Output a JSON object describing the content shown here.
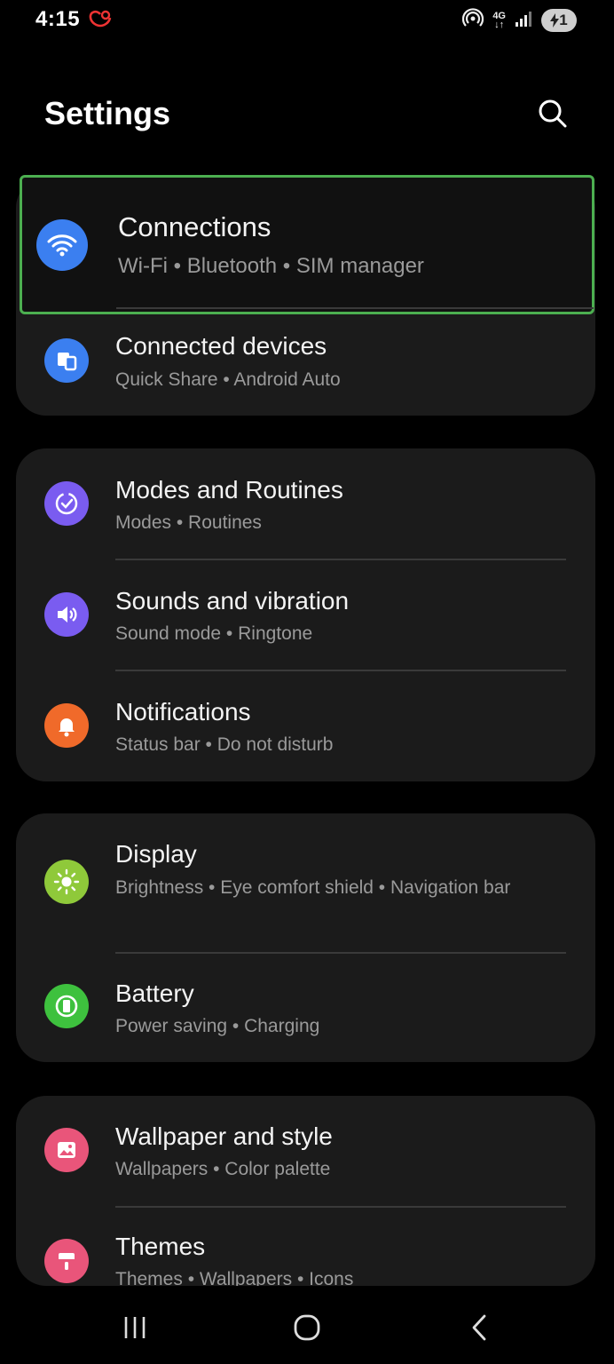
{
  "status_bar": {
    "time": "4:15",
    "network_label_top": "4G",
    "network_label_bottom": "↓↑",
    "battery_level": "1"
  },
  "header": {
    "title": "Settings"
  },
  "colors": {
    "highlight_border": "#4caf50",
    "card_background": "#1b1b1b",
    "connections_icon": "#3b7ff0",
    "connected_devices_icon": "#3b7ff0",
    "modes_icon": "#7a5cf0",
    "sounds_icon": "#7a5cf0",
    "notifications_icon": "#f06a2a",
    "display_icon": "#8fc93a",
    "battery_icon": "#3ec13e",
    "wallpaper_icon": "#e9557a",
    "themes_icon": "#e9557a"
  },
  "items": {
    "connections": {
      "title": "Connections",
      "subtitle": "Wi-Fi  •  Bluetooth  •  SIM manager",
      "icon": "wifi-icon"
    },
    "connected_devices": {
      "title": "Connected devices",
      "subtitle": "Quick Share  •  Android Auto",
      "icon": "devices-icon"
    },
    "modes_routines": {
      "title": "Modes and Routines",
      "subtitle": "Modes  •  Routines",
      "icon": "modes-icon"
    },
    "sounds": {
      "title": "Sounds and vibration",
      "subtitle": "Sound mode  •  Ringtone",
      "icon": "speaker-icon"
    },
    "notifications": {
      "title": "Notifications",
      "subtitle": "Status bar  •  Do not disturb",
      "icon": "bell-icon"
    },
    "display": {
      "title": "Display",
      "subtitle": "Brightness  •  Eye comfort shield  •  Navigation bar",
      "icon": "sun-icon"
    },
    "battery": {
      "title": "Battery",
      "subtitle": "Power saving  •  Charging",
      "icon": "battery-icon"
    },
    "wallpaper": {
      "title": "Wallpaper and style",
      "subtitle": "Wallpapers  •  Color palette",
      "icon": "image-icon"
    },
    "themes": {
      "title": "Themes",
      "subtitle": "Themes  •  Wallpapers  •  Icons",
      "icon": "brush-icon"
    }
  },
  "nav_bar": {
    "recents": "recents-icon",
    "home": "home-icon",
    "back": "back-icon"
  }
}
